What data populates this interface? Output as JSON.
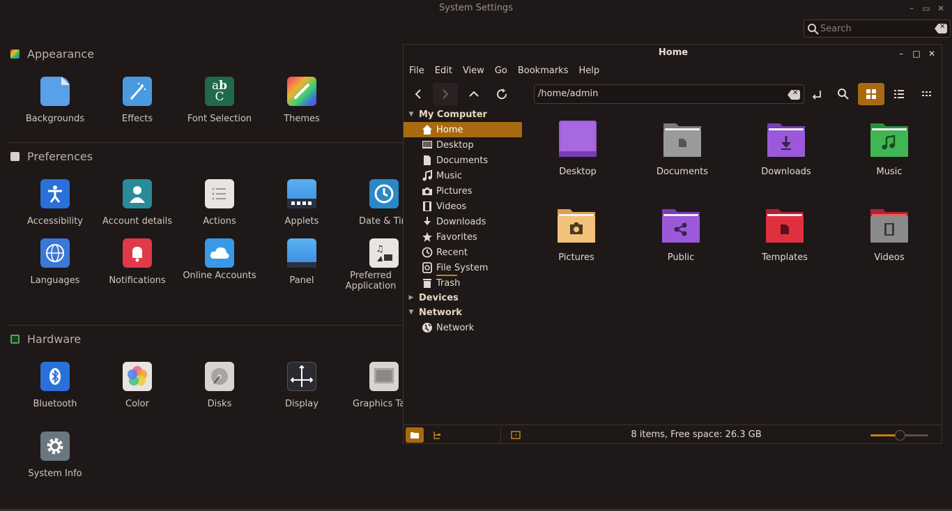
{
  "settings": {
    "title": "System Settings",
    "search_placeholder": "Search",
    "sections": {
      "appearance": "Appearance",
      "preferences": "Preferences",
      "hardware": "Hardware"
    },
    "appearance_items": [
      "Backgrounds",
      "Effects",
      "Font Selection",
      "Themes"
    ],
    "preferences_items": [
      "Accessibility",
      "Account details",
      "Actions",
      "Applets",
      "Date & Tim",
      "Languages",
      "Notifications",
      "Online Accounts",
      "Panel",
      "Preferred Application"
    ],
    "hardware_items": [
      "Bluetooth",
      "Color",
      "Disks",
      "Display",
      "Graphics Tab",
      "System Info"
    ],
    "icon_glyphs": {
      "font": "ab c"
    }
  },
  "files": {
    "title": "Home",
    "menu": [
      "File",
      "Edit",
      "View",
      "Go",
      "Bookmarks",
      "Help"
    ],
    "path": "/home/admin",
    "sidebar": {
      "my_computer": "My Computer",
      "items": [
        "Home",
        "Desktop",
        "Documents",
        "Music",
        "Pictures",
        "Videos",
        "Downloads",
        "Favorites",
        "Recent",
        "File System",
        "Trash"
      ],
      "devices": "Devices",
      "network_head": "Network",
      "network_item": "Network"
    },
    "folders": [
      "Desktop",
      "Documents",
      "Downloads",
      "Music",
      "Pictures",
      "Public",
      "Templates",
      "Videos"
    ],
    "status": "8 items, Free space: 26.3 GB",
    "zoom_level": 0.5
  },
  "colors": {
    "accent": "#a86a10",
    "folder_purple": "#9b59d9",
    "folder_gray": "#9a9a9a",
    "folder_green": "#3fb653",
    "folder_tan": "#f2c27a",
    "folder_red": "#e03040"
  }
}
